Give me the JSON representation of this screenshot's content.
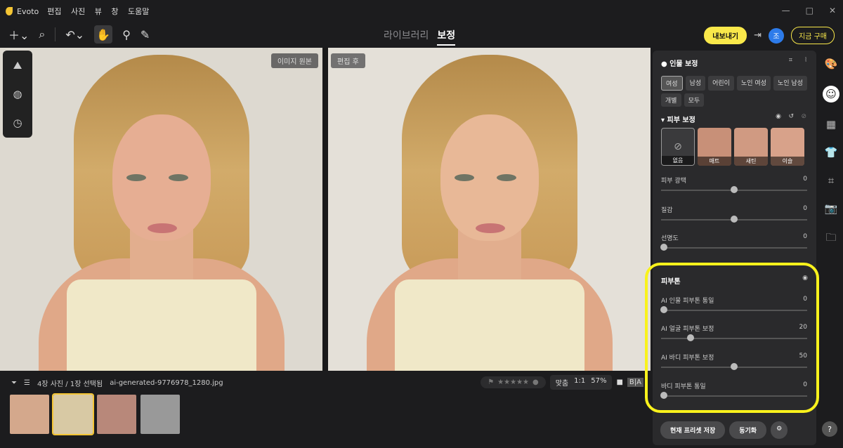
{
  "app": {
    "title": "Evoto",
    "menu": [
      "편집",
      "사진",
      "뷰",
      "창",
      "도움말"
    ],
    "window_controls": [
      "—",
      "□",
      "✕"
    ]
  },
  "header": {
    "tabs": [
      "라이브러리",
      "보정"
    ],
    "active_tab": "보정",
    "export_label": "내보내기",
    "avatar_text": "조",
    "buy_label": "지금 구매"
  },
  "canvas": {
    "orig_label": "이미지 원본",
    "after_label": "편집 후"
  },
  "filmstrip": {
    "count": "4장 사진 / 1장 선택됨",
    "file": "ai-generated-9776978_1280.jpg",
    "fit": "맞춤",
    "one": "1:1",
    "zoom": "57%",
    "stars": "★★★★★",
    "ba": "B|A"
  },
  "panel": {
    "title": "인물 보정",
    "chips": [
      "여성",
      "남성",
      "어린이",
      "노인 여성",
      "노인 남성",
      "개별",
      "모두"
    ],
    "active_chip": "여성",
    "skin_title": "피부 보정",
    "presets": [
      "없음",
      "매트",
      "새틴",
      "이슬"
    ],
    "sliders": [
      {
        "label": "피부 광택",
        "value": "0",
        "pos": 0.5
      },
      {
        "label": "질감",
        "value": "0",
        "pos": 0.5
      },
      {
        "label": "선명도",
        "value": "0",
        "pos": 0.0
      }
    ],
    "tone_title": "피부톤",
    "tone_sliders": [
      {
        "label": "AI 인물 피부톤 통일",
        "value": "0",
        "pos": 0.0
      },
      {
        "label": "AI 얼굴 피부톤 보정",
        "value": "20",
        "pos": 0.2
      },
      {
        "label": "AI 바디 피부톤 보정",
        "value": "50",
        "pos": 0.5
      },
      {
        "label": "바디 피부톤 통일",
        "value": "0",
        "pos": 0.0
      }
    ],
    "save_preset": "현재 프리셋 저장",
    "sync": "동기화"
  },
  "highlight_color": "#f9f21c"
}
